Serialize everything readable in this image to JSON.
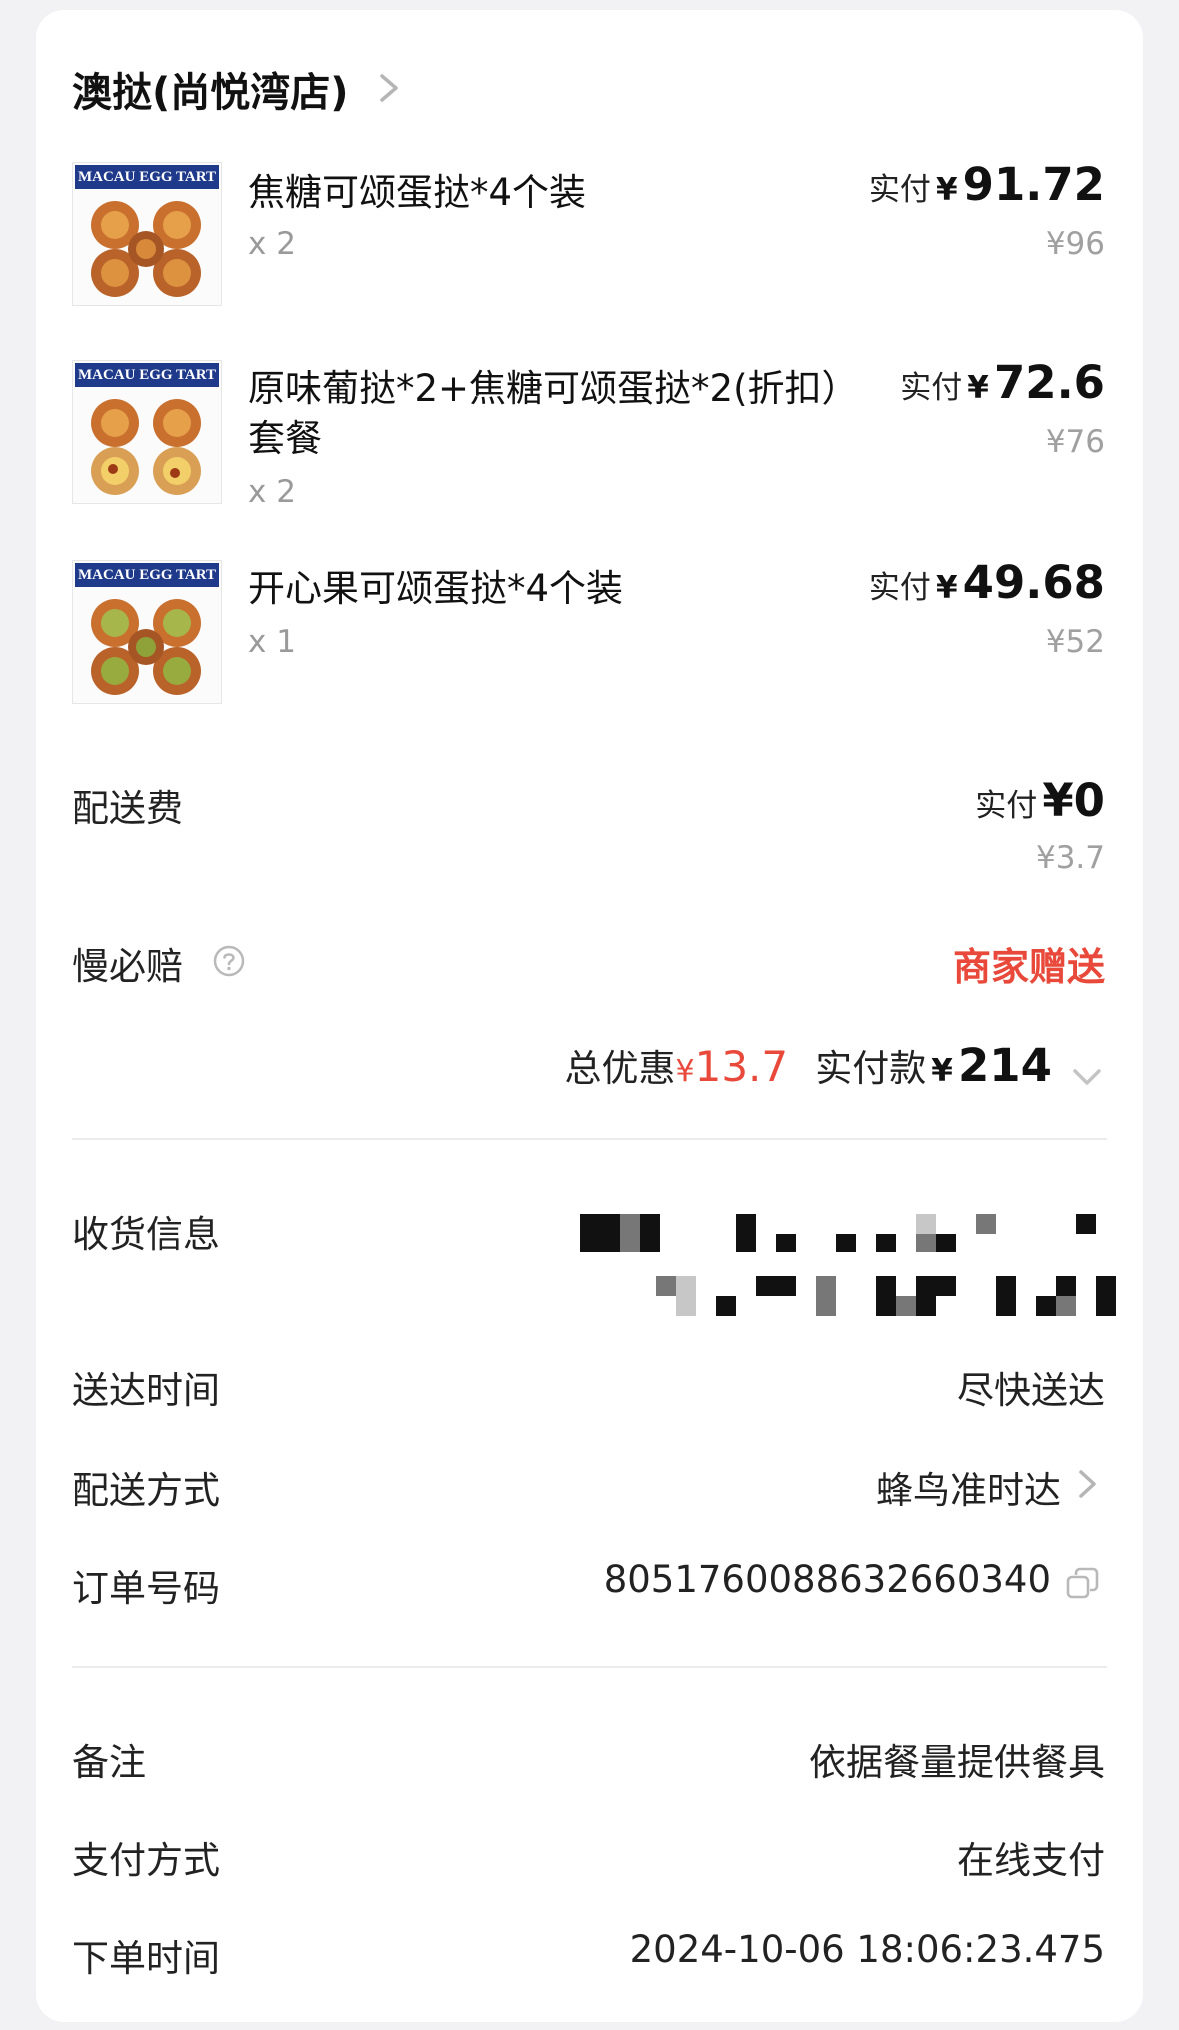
{
  "shop": {
    "name": "澳挞(尚悦湾店)"
  },
  "items": [
    {
      "image_text": "MACAU EGG TART",
      "name": "焦糖可颂蛋挞*4个装",
      "qty": "x 2",
      "paid_label": "实付",
      "paid_yen": "¥",
      "paid_value": "91.72",
      "original": "¥96"
    },
    {
      "image_text": "MACAU EGG TART",
      "name": "原味葡挞*2+焦糖可颂蛋挞*2(折扣）套餐",
      "qty": "x 2",
      "paid_label": "实付",
      "paid_yen": "¥",
      "paid_value": "72.6",
      "original": "¥76"
    },
    {
      "image_text": "MACAU EGG TART",
      "name": "开心果可颂蛋挞*4个装",
      "qty": "x 1",
      "paid_label": "实付",
      "paid_yen": "¥",
      "paid_value": "49.68",
      "original": "¥52"
    }
  ],
  "delivery_fee": {
    "label": "配送费",
    "paid_label": "实付",
    "paid_value": "¥0",
    "original": "¥3.7"
  },
  "slow_compensation": {
    "label": "慢必赔",
    "value": "商家赠送"
  },
  "totals": {
    "discount_label": "总优惠",
    "discount_yen": "¥",
    "discount_value": "13.7",
    "pay_label": "实付款",
    "pay_yen": "¥",
    "pay_value": "214"
  },
  "receiver": {
    "label": "收货信息"
  },
  "delivery_time": {
    "label": "送达时间",
    "value": "尽快送达"
  },
  "delivery_method": {
    "label": "配送方式",
    "value": "蜂鸟准时达"
  },
  "order_no": {
    "label": "订单号码",
    "value": "8051760088632660340"
  },
  "remark": {
    "label": "备注",
    "value": "依据餐量提供餐具"
  },
  "payment": {
    "label": "支付方式",
    "value": "在线支付"
  },
  "order_time": {
    "label": "下单时间",
    "value": "2024-10-06 18:06:23.475"
  },
  "colors": {
    "discount_red": "#e8493a",
    "brand_blue": "#1f3a8a"
  },
  "icons": {
    "shop_chevron": "chevron-right-icon",
    "help": "question-circle-icon",
    "expand": "chevron-down-icon",
    "method_chevron": "chevron-right-icon",
    "copy": "copy-icon"
  }
}
